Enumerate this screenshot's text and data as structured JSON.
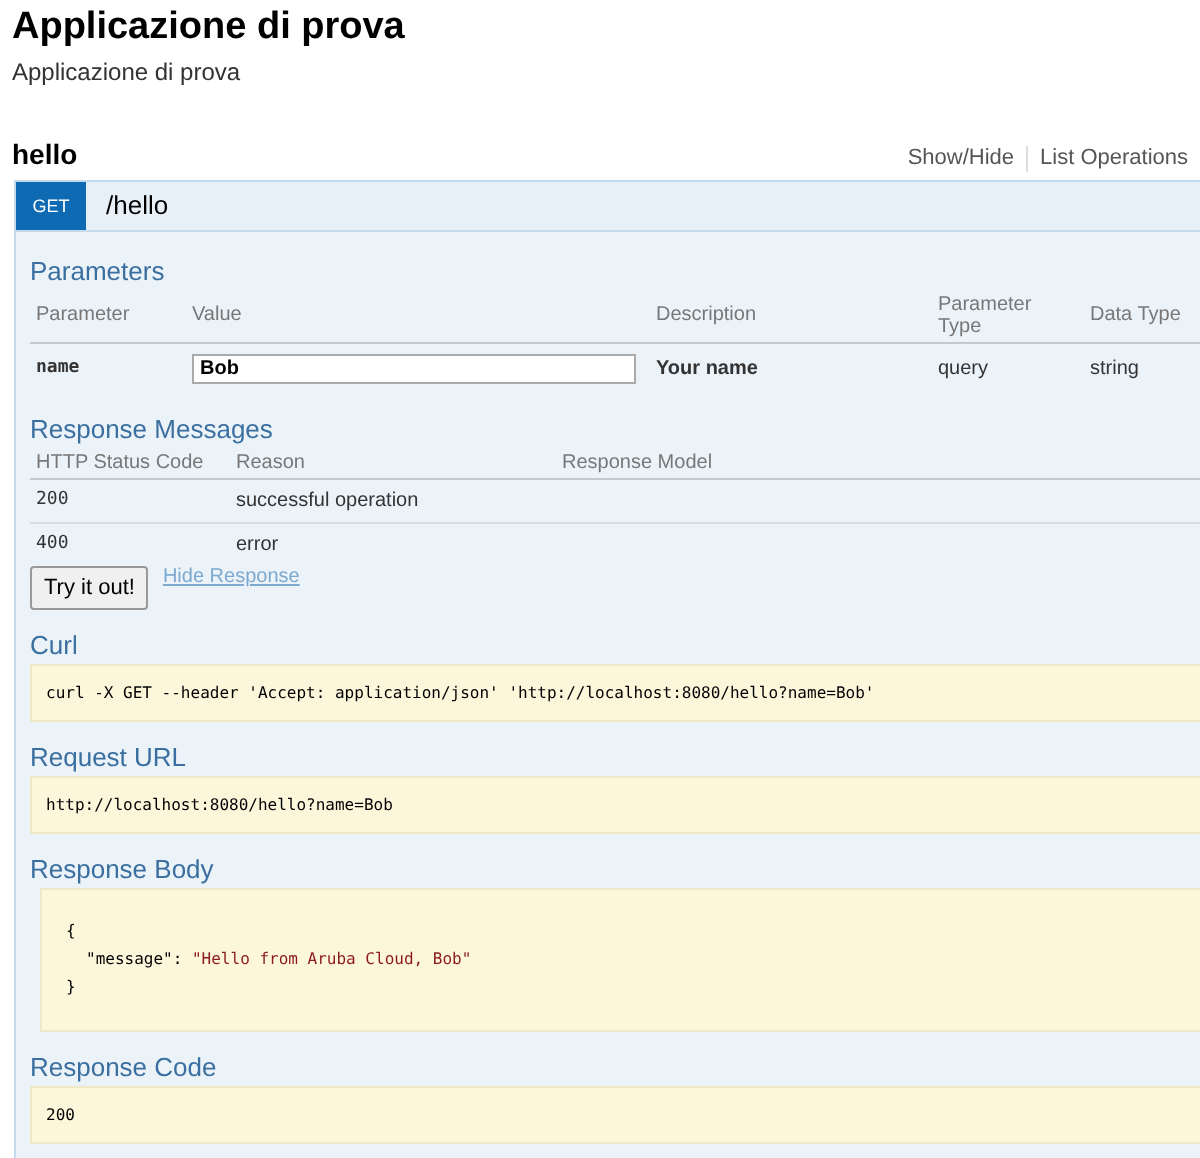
{
  "header": {
    "title": "Applicazione di prova",
    "description": "Applicazione di prova"
  },
  "resource": {
    "name": "hello",
    "links": [
      "Show/Hide",
      "List Operations"
    ]
  },
  "operation": {
    "method": "GET",
    "path": "/hello",
    "parameters": {
      "heading": "Parameters",
      "columns": [
        "Parameter",
        "Value",
        "Description",
        "Parameter Type",
        "Data Type"
      ],
      "rows": [
        {
          "name": "name",
          "value": "Bob",
          "description": "Your name",
          "type": "query",
          "data_type": "string"
        }
      ]
    },
    "responses": {
      "heading": "Response Messages",
      "columns": [
        "HTTP Status Code",
        "Reason",
        "Response Model"
      ],
      "rows": [
        {
          "code": "200",
          "reason": "successful operation"
        },
        {
          "code": "400",
          "reason": "error"
        }
      ]
    },
    "try_button": "Try it out!",
    "hide_link": "Hide Response",
    "curl": {
      "heading": "Curl",
      "text": "curl -X GET --header 'Accept: application/json' 'http://localhost:8080/hello?name=Bob'"
    },
    "request_url": {
      "heading": "Request URL",
      "text": "http://localhost:8080/hello?name=Bob"
    },
    "response_body": {
      "heading": "Response Body",
      "lines": [
        {
          "kind": "punct",
          "text": "{"
        },
        {
          "kind": "pair",
          "key": "\"message\":",
          "value": "\"Hello from Aruba Cloud, Bob\""
        },
        {
          "kind": "punct",
          "text": "}"
        }
      ]
    },
    "response_code": {
      "heading": "Response Code",
      "text": "200"
    }
  }
}
